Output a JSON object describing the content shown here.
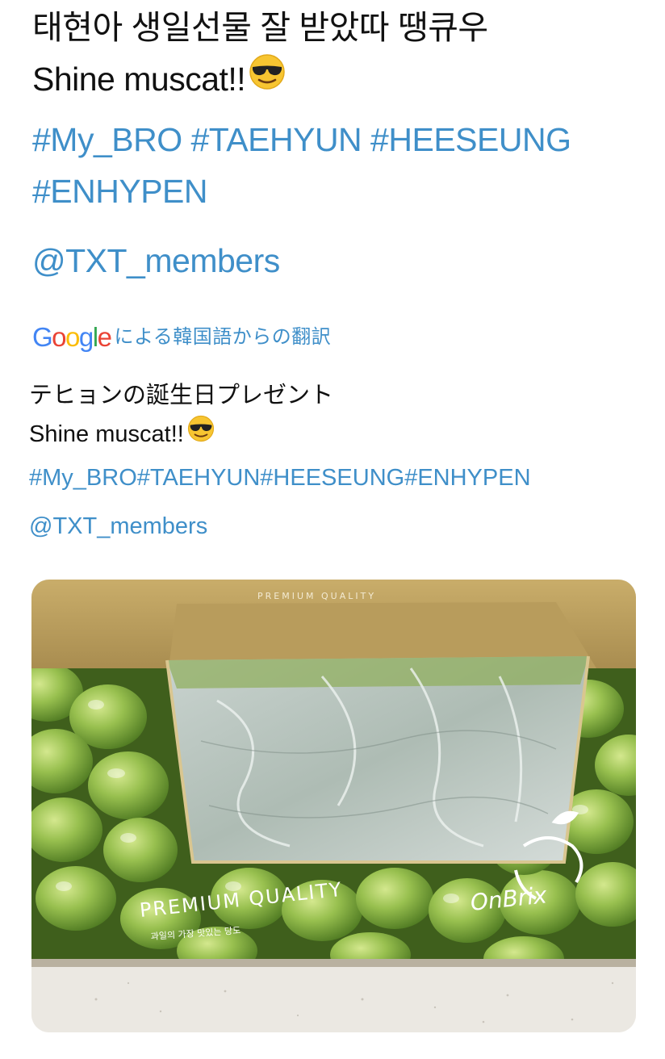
{
  "tweet": {
    "line1": "태현아 생일선물 잘 받았따 땡큐우",
    "line2": "Shine muscat!!",
    "line2_emoji": "smiling-face-with-sunglasses",
    "hashtags_line1": "#My_BRO #TAEHYUN #HEESEUNG",
    "hashtags_line2": "#ENHYPEN",
    "mention": "@TXT_members"
  },
  "translation": {
    "provider_logo": "Google",
    "provider_suffix": "による韓国語からの翻訳",
    "line1": "テヒョンの誕生日プレゼント",
    "line2": "Shine muscat!!",
    "line2_emoji": "smiling-face-with-sunglasses",
    "hashtags": "#My_BRO#TAEHYUN#HEESEUNG#ENHYPEN",
    "mention": "@TXT_members"
  },
  "media": {
    "top_flap_text": "PREMIUM QUALITY",
    "box_text_main": "PREMIUM QUALITY",
    "box_text_sub": "과일의 가장 맛있는 당도",
    "brand": "OnBrix"
  },
  "colors": {
    "link": "#3f8fc9",
    "text": "#111111",
    "background": "#ffffff",
    "grape": "#8fb84a",
    "box_kraft": "#b59a5e"
  }
}
